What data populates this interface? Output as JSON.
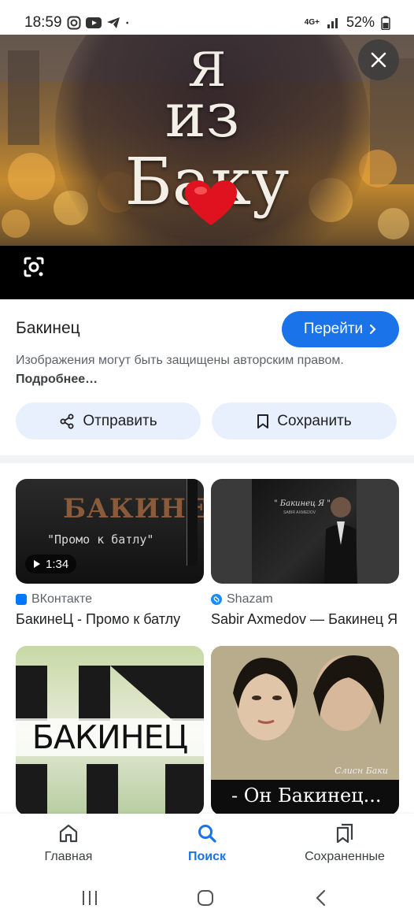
{
  "status_bar": {
    "time": "18:59",
    "network": "4G+",
    "battery": "52%"
  },
  "hero": {
    "line1": "Я",
    "line2": "из",
    "line3": "Баку"
  },
  "info": {
    "site_name": "Бакинец",
    "go_label": "Перейти",
    "copyright_text": "Изображения могут быть защищены авторским правом.",
    "more_link": "Подробнее…",
    "share_label": "Отправить",
    "save_label": "Сохранить"
  },
  "results": [
    {
      "source": "ВКонтакте",
      "title": "БакинеЦ - Промо к батлу",
      "duration": "1:34",
      "thumb_title": "БАКИНЕЦ",
      "thumb_sub": "\"Промо к батлу\"",
      "source_color": "#0077ff"
    },
    {
      "source": "Shazam",
      "title": "Sabir Axmedov — Бакинец Я",
      "thumb_title": "\" Бакинец Я \"",
      "thumb_sub": "SABIR AXMEDOV",
      "source_color": "#1a8cff"
    },
    {
      "source": "",
      "title": "",
      "thumb_title": "БАКИНЕЦ"
    },
    {
      "source": "",
      "title": "",
      "thumb_title": "- Он Бакинец...",
      "thumb_sub": "Cлисн Бакu"
    }
  ],
  "bottom_nav": {
    "home": "Главная",
    "search": "Поиск",
    "saved": "Сохраненные"
  },
  "colors": {
    "accent": "#1a73e8",
    "chip": "#e8f0fe"
  },
  "icons": [
    "close-icon",
    "lens-icon",
    "share-icon",
    "bookmark-icon",
    "home-icon",
    "search-icon",
    "saved-icon"
  ]
}
